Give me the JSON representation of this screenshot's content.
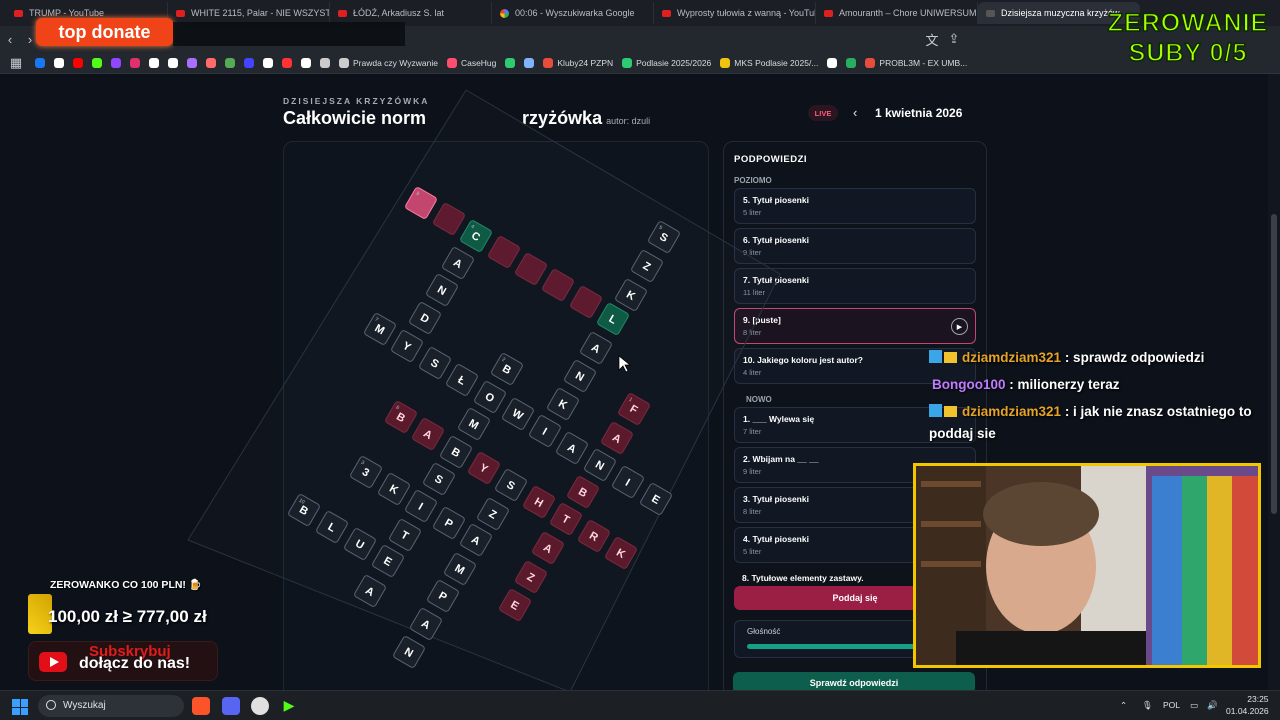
{
  "browser": {
    "tabs": [
      {
        "label": "TRUMP - YouTube",
        "icon": "youtube-icon"
      },
      {
        "label": "WHITE 2115, Palar - NIE WSZYSTKO",
        "icon": "youtube-icon"
      },
      {
        "label": "ŁÓDŹ, Arkadiusz S. lat",
        "icon": "youtube-icon"
      },
      {
        "label": "00:06 - Wyszukiwarka Google",
        "icon": "google-icon"
      },
      {
        "label": "Wyprosty tułowia z wanną - YouTube",
        "icon": "youtube-icon"
      },
      {
        "label": "Amouranth – Chore UNIWERSUM B",
        "icon": "youtube-icon"
      },
      {
        "label": "Dzisiejsza muzyczna krzyżów",
        "icon": "page-icon"
      }
    ],
    "bookmarks": [
      {
        "label": "",
        "color": "#1877f2"
      },
      {
        "label": "",
        "color": "#ffffff"
      },
      {
        "label": "",
        "color": "#ff0000"
      },
      {
        "label": "",
        "color": "#53fc18"
      },
      {
        "label": "",
        "color": "#9146ff"
      },
      {
        "label": "",
        "color": "#e1306c"
      },
      {
        "label": "",
        "color": "#ffffff"
      },
      {
        "label": "",
        "color": "#ffffff"
      },
      {
        "label": "",
        "color": "#a970ff"
      },
      {
        "label": "",
        "color": "#ff6b6b"
      },
      {
        "label": "",
        "color": "#55aa55"
      },
      {
        "label": "",
        "color": "#4444ff"
      },
      {
        "label": "",
        "color": "#ffffff"
      },
      {
        "label": "",
        "color": "#ff3333"
      },
      {
        "label": "",
        "color": "#ffffff"
      },
      {
        "label": "",
        "color": "#cccccc"
      },
      {
        "label": "Prawda czy Wyzwanie",
        "color": "#cccccc"
      },
      {
        "label": "CaseHug",
        "color": "#ff4d6d"
      },
      {
        "label": "",
        "color": "#2ecc71"
      },
      {
        "label": "",
        "color": "#7fb3ff"
      },
      {
        "label": "Kluby24 PZPN",
        "color": "#e74c3c"
      },
      {
        "label": "Podlasie 2025/2026",
        "color": "#2ecc71"
      },
      {
        "label": "MKS Podlasie 2025/...",
        "color": "#f1c40f"
      },
      {
        "label": "",
        "color": "#ffffff"
      },
      {
        "label": "",
        "color": "#27ae60"
      },
      {
        "label": "PROBL3M - EX UMB...",
        "color": "#e74c3c"
      }
    ]
  },
  "page": {
    "kicker": "DZISIEJSZA KRZYŻÓWKA",
    "title_left": "Całkowicie norm",
    "title_right": "rzyżówka",
    "author": "autor: dzuli",
    "live": "LIVE",
    "date": "1 kwietnia 2026"
  },
  "clues": {
    "header": "PODPOWIEDZI",
    "across_label": "POZIOMO",
    "down_label": "NOWO",
    "across": [
      {
        "title": "5. Tytuł piosenki",
        "len": "5 liter"
      },
      {
        "title": "6. Tytuł piosenki",
        "len": "9 liter"
      },
      {
        "title": "7. Tytuł piosenki",
        "len": "11 liter"
      },
      {
        "title": "9. [puste]",
        "len": "8 liter"
      },
      {
        "title": "10. Jakiego koloru jest autor?",
        "len": "4 liter"
      }
    ],
    "down": [
      {
        "title": "1. ___ Wylewa się",
        "len": "7 liter"
      },
      {
        "title": "2. Wbijam na __ __",
        "len": "9 liter"
      },
      {
        "title": "3. Tytuł piosenki",
        "len": "8 liter"
      },
      {
        "title": "4. Tytuł piosenki",
        "len": "5 liter"
      },
      {
        "title": "8. Tytułowe elementy zastawy.",
        "len": ""
      }
    ],
    "give_up": "Poddaj się",
    "volume": "Głośność",
    "volume_level": 0.8,
    "check": "Sprawdź odpowiedzi"
  },
  "overlay": {
    "top_donate": "top donate",
    "zerowanie_line1": "ZEROWANIE",
    "zerowanie_line2": "SUBY 0/5",
    "goal_label": "ZEROWANKO CO 100 PLN! 🍺",
    "goal_value": "100,00 zł ≥ 777,00 zł",
    "sub_red": "Subskrybuj",
    "sub_white": "dołącz do nas!",
    "chat": [
      {
        "user": "dziamdziam321",
        "msg": ": sprawdz odpowiedzi",
        "badges": true
      },
      {
        "user": "Bongoo100",
        "msg": ": milionerzy teraz",
        "badges": false
      },
      {
        "user": "dziamdziam321",
        "msg": ": i jak nie znasz ostatniego to poddaj sie",
        "badges": true
      }
    ]
  },
  "grid": {
    "cells": [
      {
        "c": "",
        "s": "pink",
        "n": "9"
      },
      {
        "c": "",
        "s": "pinkdim",
        "n": ""
      },
      {
        "c": "C",
        "s": "green",
        "n": "4"
      },
      {
        "c": "",
        "s": "pinkdim",
        "n": ""
      },
      {
        "c": "",
        "s": "pinkdim",
        "n": ""
      },
      {
        "c": "",
        "s": "pinkdim",
        "n": ""
      },
      {
        "c": "",
        "s": "pinkdim",
        "n": ""
      },
      {
        "c": "L",
        "s": "green",
        "n": ""
      },
      {
        "c": "S",
        "s": "",
        "n": "5"
      },
      {
        "c": "Z",
        "s": "",
        "n": ""
      },
      {
        "c": "K",
        "s": "",
        "n": ""
      },
      {
        "c": "A",
        "s": "",
        "n": ""
      },
      {
        "c": "N",
        "s": "",
        "n": ""
      },
      {
        "c": "D",
        "s": "",
        "n": ""
      },
      {
        "c": "M",
        "s": "",
        "n": "7"
      },
      {
        "c": "Y",
        "s": "",
        "n": ""
      },
      {
        "c": "S",
        "s": "",
        "n": ""
      },
      {
        "c": "Ł",
        "s": "",
        "n": ""
      },
      {
        "c": "O",
        "s": "",
        "n": ""
      },
      {
        "c": "W",
        "s": "",
        "n": ""
      },
      {
        "c": "I",
        "s": "",
        "n": ""
      },
      {
        "c": "A",
        "s": "",
        "n": ""
      },
      {
        "c": "N",
        "s": "",
        "n": ""
      },
      {
        "c": "I",
        "s": "",
        "n": ""
      },
      {
        "c": "E",
        "s": "",
        "n": ""
      },
      {
        "c": "A",
        "s": "",
        "n": ""
      },
      {
        "c": "N",
        "s": "",
        "n": ""
      },
      {
        "c": "K",
        "s": "",
        "n": ""
      },
      {
        "c": "B",
        "s": "",
        "n": "2"
      },
      {
        "c": "F",
        "s": "red",
        "n": "1"
      },
      {
        "c": "A",
        "s": "red",
        "n": ""
      },
      {
        "c": "B",
        "s": "red",
        "n": "6"
      },
      {
        "c": "A",
        "s": "red",
        "n": ""
      },
      {
        "c": "M",
        "s": "",
        "n": ""
      },
      {
        "c": "B",
        "s": "",
        "n": ""
      },
      {
        "c": "Y",
        "s": "red",
        "n": ""
      },
      {
        "c": "S",
        "s": "",
        "n": ""
      },
      {
        "c": "H",
        "s": "red",
        "n": ""
      },
      {
        "c": "T",
        "s": "red",
        "n": ""
      },
      {
        "c": "R",
        "s": "red",
        "n": ""
      },
      {
        "c": "K",
        "s": "red",
        "n": ""
      },
      {
        "c": "B",
        "s": "red",
        "n": ""
      },
      {
        "c": "3",
        "s": "",
        "n": "3"
      },
      {
        "c": "K",
        "s": "",
        "n": ""
      },
      {
        "c": "I",
        "s": "",
        "n": ""
      },
      {
        "c": "P",
        "s": "",
        "n": ""
      },
      {
        "c": "A",
        "s": "",
        "n": ""
      },
      {
        "c": "S",
        "s": "",
        "n": ""
      },
      {
        "c": "Z",
        "s": "",
        "n": ""
      },
      {
        "c": "A",
        "s": "red",
        "n": ""
      },
      {
        "c": "Z",
        "s": "red",
        "n": ""
      },
      {
        "c": "E",
        "s": "red",
        "n": ""
      },
      {
        "c": "B",
        "s": "",
        "n": "10"
      },
      {
        "c": "L",
        "s": "",
        "n": ""
      },
      {
        "c": "U",
        "s": "",
        "n": ""
      },
      {
        "c": "E",
        "s": "",
        "n": ""
      },
      {
        "c": "T",
        "s": "",
        "n": ""
      },
      {
        "c": "A",
        "s": "",
        "n": ""
      },
      {
        "c": "M",
        "s": "",
        "n": ""
      },
      {
        "c": "P",
        "s": "",
        "n": ""
      },
      {
        "c": "A",
        "s": "",
        "n": ""
      },
      {
        "c": "N",
        "s": "",
        "n": ""
      }
    ]
  },
  "taskbar": {
    "search": "Wyszukaj",
    "lang": "POL",
    "time": "23:25",
    "date": "01.04.2026"
  }
}
